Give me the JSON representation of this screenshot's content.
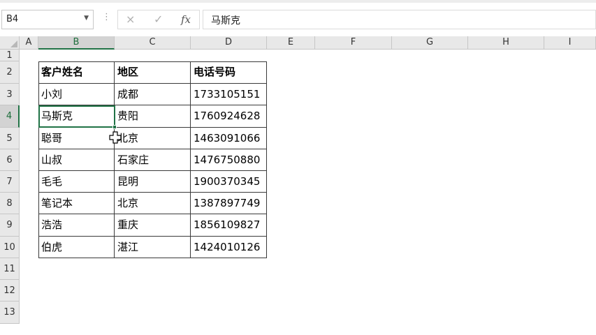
{
  "formula_bar": {
    "name_box": "B4",
    "formula": "马斯克",
    "cancel_icon": "×",
    "enter_icon": "✓",
    "fx_icon": "fx",
    "grip_icon": "⋮"
  },
  "columns": [
    "A",
    "B",
    "C",
    "D",
    "E",
    "F",
    "G",
    "H",
    "I"
  ],
  "rows": [
    "1",
    "2",
    "3",
    "4",
    "5",
    "6",
    "7",
    "8",
    "9",
    "10",
    "11",
    "12",
    "13"
  ],
  "table": {
    "headers": [
      "客户姓名",
      "地区",
      "电话号码"
    ],
    "rows": [
      [
        "小刘",
        "成都",
        "1733105151"
      ],
      [
        "马斯克",
        "贵阳",
        "1760924628"
      ],
      [
        "聪哥",
        "北京",
        "1463091066"
      ],
      [
        "山叔",
        "石家庄",
        "1476750880"
      ],
      [
        "毛毛",
        "昆明",
        "1900370345"
      ],
      [
        "笔记本",
        "北京",
        "1387897749"
      ],
      [
        "浩浩",
        "重庆",
        "1856109827"
      ],
      [
        "伯虎",
        "湛江",
        "1424010126"
      ]
    ]
  },
  "active_cell": "B4",
  "active_column": "B",
  "active_row": "4",
  "colors": {
    "accent": "#217346",
    "header_bg": "#e8e8e8",
    "header_active_bg": "#d3d3d3",
    "gridline": "#c6c6c6"
  }
}
